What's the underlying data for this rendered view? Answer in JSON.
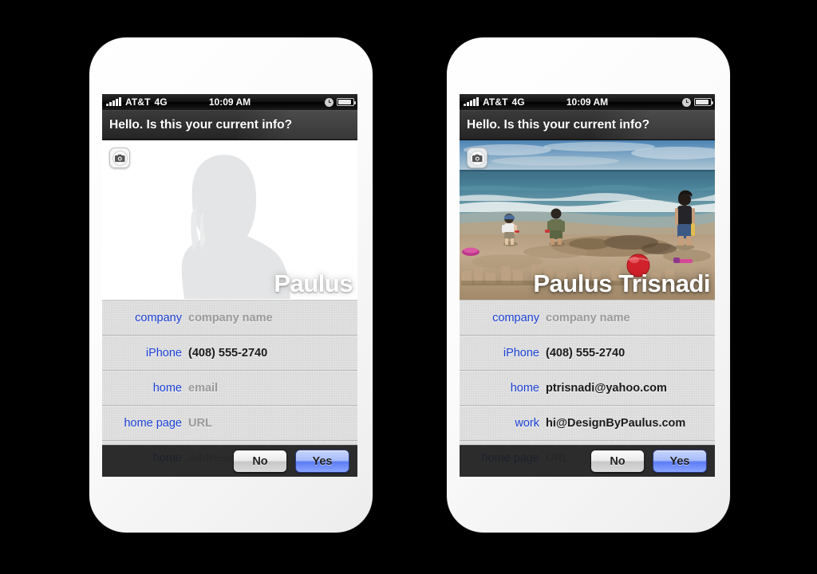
{
  "canvas": {
    "background": "#000000"
  },
  "phones": [
    {
      "id": "left",
      "statusbar": {
        "carrier": "AT&T",
        "network": "4G",
        "time": "10:09 AM",
        "signal_icon": "signal-bars-icon",
        "clock_icon": "alarm-clock-icon",
        "battery_icon": "battery-icon"
      },
      "header": {
        "title": "Hello. Is this your current info?"
      },
      "photo": {
        "type": "placeholder",
        "camera_icon": "camera-icon",
        "name": "Paulus",
        "alt": "Gray silhouette placeholder of a person with long hair"
      },
      "fields": [
        {
          "label": "company",
          "value": "company name",
          "empty": true
        },
        {
          "label": "iPhone",
          "value": "(408) 555-2740",
          "empty": false
        },
        {
          "label": "home",
          "value": "email",
          "empty": true
        },
        {
          "label": "home page",
          "value": "URL",
          "empty": true
        },
        {
          "label": "home",
          "value": "address",
          "empty": true
        }
      ],
      "actions": {
        "no_label": "No",
        "yes_label": "Yes"
      }
    },
    {
      "id": "right",
      "statusbar": {
        "carrier": "AT&T",
        "network": "4G",
        "time": "10:09 AM",
        "signal_icon": "signal-bars-icon",
        "clock_icon": "alarm-clock-icon",
        "battery_icon": "battery-icon"
      },
      "header": {
        "title": "Hello. Is this your current info?"
      },
      "photo": {
        "type": "beach-photo",
        "camera_icon": "camera-icon",
        "name": "Paulus Trisnadi",
        "alt": "Beach scene: three people standing at the shoreline with sandcastles and a red ball in the foreground"
      },
      "fields": [
        {
          "label": "company",
          "value": "company name",
          "empty": true
        },
        {
          "label": "iPhone",
          "value": "(408) 555-2740",
          "empty": false
        },
        {
          "label": "home",
          "value": "ptrisnadi@yahoo.com",
          "empty": false
        },
        {
          "label": "work",
          "value": "hi@DesignByPaulus.com",
          "empty": false
        },
        {
          "label": "home page",
          "value": "URL",
          "empty": true
        }
      ],
      "actions": {
        "no_label": "No",
        "yes_label": "Yes"
      }
    }
  ],
  "colors": {
    "label_blue": "#1a3fd4",
    "field_background": "#dcdcdc",
    "header_dark": "#303030",
    "yes_button": "#7e9cff",
    "placeholder_gray": "#9a9a9a"
  }
}
